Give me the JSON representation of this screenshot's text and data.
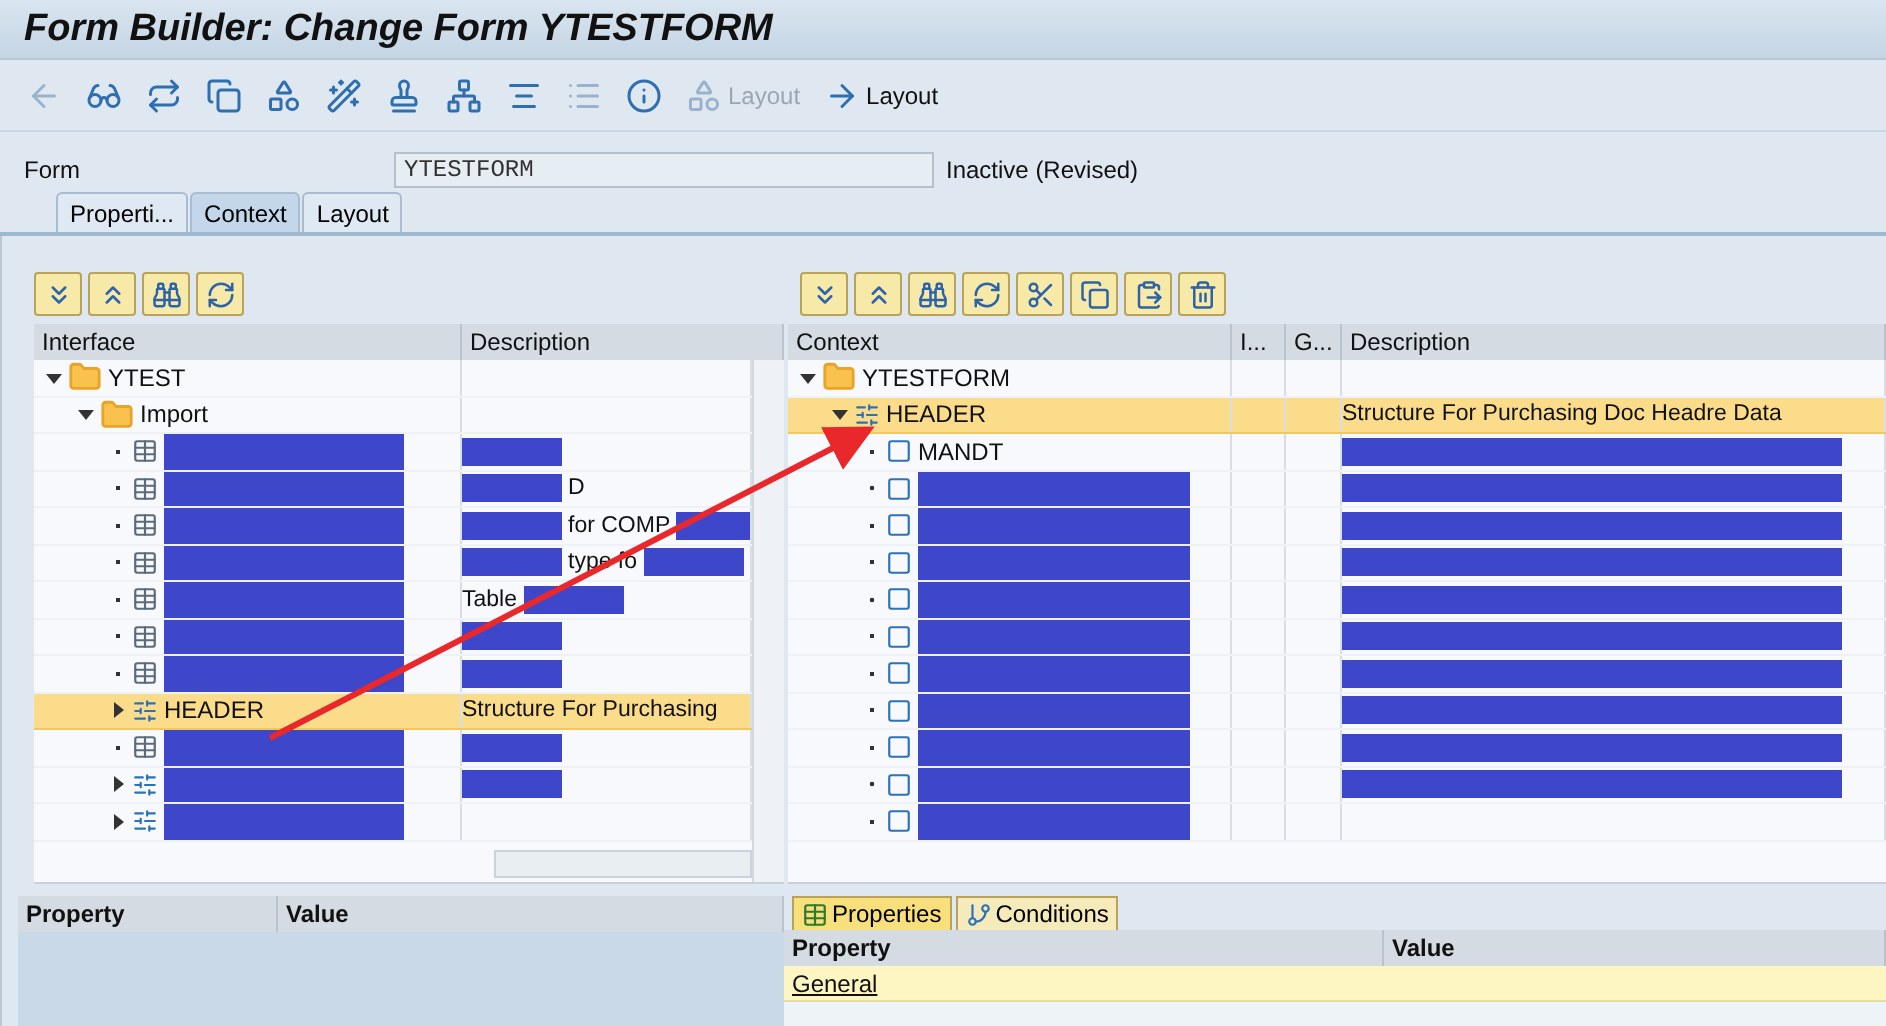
{
  "window": {
    "title": "Form Builder: Change Form YTESTFORM"
  },
  "toolbar": [
    {
      "kind": "back",
      "disabled": true
    },
    {
      "kind": "glasses",
      "disabled": false
    },
    {
      "kind": "swap",
      "disabled": false
    },
    {
      "kind": "copy",
      "disabled": false
    },
    {
      "kind": "shapes",
      "disabled": false
    },
    {
      "kind": "wand",
      "disabled": false
    },
    {
      "kind": "stamp",
      "disabled": false
    },
    {
      "kind": "hierarchy",
      "disabled": false
    },
    {
      "kind": "align",
      "disabled": false
    },
    {
      "kind": "list",
      "disabled": true
    },
    {
      "kind": "info",
      "disabled": false
    },
    {
      "kind": "shapes",
      "label": "Layout",
      "disabled": true
    },
    {
      "kind": "forward",
      "label": "Layout",
      "disabled": false
    }
  ],
  "form": {
    "label": "Form",
    "value": "YTESTFORM",
    "status": "Inactive (Revised)"
  },
  "tabs": [
    {
      "label": "Properti...",
      "selected": false
    },
    {
      "label": "Context",
      "selected": true
    },
    {
      "label": "Layout",
      "selected": false
    }
  ],
  "interface_tree": {
    "buttons": [
      {
        "kind": "expand"
      },
      {
        "kind": "collapse"
      },
      {
        "kind": "find"
      },
      {
        "kind": "refresh"
      }
    ],
    "columns": [
      "Interface",
      "Description"
    ],
    "nodes": [
      {
        "name": "YTEST",
        "kind": "folder",
        "expanded": true,
        "selected": false,
        "children": [
          {
            "name": "Import",
            "kind": "folder",
            "expanded": true,
            "selected": false,
            "children": [
              {
                "kind": "table",
                "redacted": true,
                "selected": false,
                "description": [
                  {
                    "kind": "redacted"
                  }
                ]
              },
              {
                "kind": "table",
                "redacted": true,
                "selected": false,
                "description": [
                  {
                    "kind": "redacted"
                  },
                  {
                    "kind": "text",
                    "text": "D"
                  }
                ]
              },
              {
                "kind": "table",
                "redacted": true,
                "selected": false,
                "description": [
                  {
                    "kind": "redacted"
                  },
                  {
                    "kind": "text",
                    "text": "for COMP"
                  },
                  {
                    "kind": "redacted"
                  }
                ]
              },
              {
                "kind": "table",
                "redacted": true,
                "selected": false,
                "description": [
                  {
                    "kind": "redacted"
                  },
                  {
                    "kind": "text",
                    "text": "type fo"
                  },
                  {
                    "kind": "redacted"
                  }
                ]
              },
              {
                "kind": "table",
                "redacted": true,
                "selected": false,
                "description": [
                  {
                    "kind": "text",
                    "text": "Table"
                  },
                  {
                    "kind": "redacted"
                  }
                ]
              },
              {
                "kind": "table",
                "redacted": true,
                "selected": false,
                "description": [
                  {
                    "kind": "redacted"
                  }
                ]
              },
              {
                "kind": "table",
                "redacted": true,
                "selected": false,
                "description": [
                  {
                    "kind": "redacted"
                  }
                ]
              },
              {
                "name": "HEADER",
                "kind": "structure",
                "expanded": false,
                "selected": true,
                "description": [
                  {
                    "kind": "text",
                    "text": "Structure For Purchasing"
                  }
                ]
              },
              {
                "kind": "table",
                "redacted": true,
                "selected": false,
                "description": [
                  {
                    "kind": "redacted"
                  }
                ]
              },
              {
                "kind": "structure",
                "redacted": true,
                "expanded": false,
                "selected": false,
                "description": [
                  {
                    "kind": "redacted"
                  }
                ]
              },
              {
                "kind": "structure",
                "redacted": true,
                "expanded": false,
                "selected": false
              }
            ]
          }
        ]
      }
    ]
  },
  "context_tree": {
    "buttons": [
      {
        "kind": "expand"
      },
      {
        "kind": "collapse"
      },
      {
        "kind": "find"
      },
      {
        "kind": "refresh"
      },
      {
        "kind": "cut"
      },
      {
        "kind": "copy"
      },
      {
        "kind": "paste"
      },
      {
        "kind": "delete"
      }
    ],
    "columns": [
      "Context",
      "I...",
      "G...",
      "Description"
    ],
    "nodes": [
      {
        "name": "YTESTFORM",
        "kind": "folder",
        "expanded": true,
        "selected": false,
        "children": [
          {
            "name": "HEADER",
            "kind": "structure",
            "expanded": true,
            "selected": true,
            "description": [
              {
                "kind": "text",
                "text": "Structure For Purchasing Doc Headre Data"
              }
            ],
            "children": [
              {
                "name": "MANDT",
                "kind": "field",
                "selected": false,
                "description": [
                  {
                    "kind": "redacted"
                  }
                ]
              },
              {
                "kind": "field",
                "redacted": true,
                "selected": false,
                "description": [
                  {
                    "kind": "redacted"
                  }
                ]
              },
              {
                "kind": "field",
                "redacted": true,
                "selected": false,
                "description": [
                  {
                    "kind": "redacted"
                  }
                ]
              },
              {
                "kind": "field",
                "redacted": true,
                "selected": false,
                "description": [
                  {
                    "kind": "redacted"
                  }
                ]
              },
              {
                "kind": "field",
                "redacted": true,
                "selected": false,
                "description": [
                  {
                    "kind": "redacted"
                  }
                ]
              },
              {
                "kind": "field",
                "redacted": true,
                "selected": false,
                "description": [
                  {
                    "kind": "redacted"
                  }
                ]
              },
              {
                "kind": "field",
                "redacted": true,
                "selected": false,
                "description": [
                  {
                    "kind": "redacted"
                  }
                ]
              },
              {
                "kind": "field",
                "redacted": true,
                "selected": false,
                "description": [
                  {
                    "kind": "redacted"
                  }
                ]
              },
              {
                "kind": "field",
                "redacted": true,
                "selected": false,
                "description": [
                  {
                    "kind": "redacted"
                  }
                ]
              },
              {
                "kind": "field",
                "redacted": true,
                "selected": false,
                "description": [
                  {
                    "kind": "redacted"
                  }
                ]
              },
              {
                "kind": "field",
                "redacted": true,
                "selected": false
              }
            ]
          }
        ]
      }
    ]
  },
  "left_properties": {
    "columns": [
      "Property",
      "Value"
    ]
  },
  "right_properties": {
    "tabs": [
      {
        "label": "Properties",
        "kind": "properties",
        "selected": true
      },
      {
        "label": "Conditions",
        "kind": "conditions",
        "selected": false
      }
    ],
    "columns": [
      "Property",
      "Value"
    ],
    "group": "General"
  }
}
